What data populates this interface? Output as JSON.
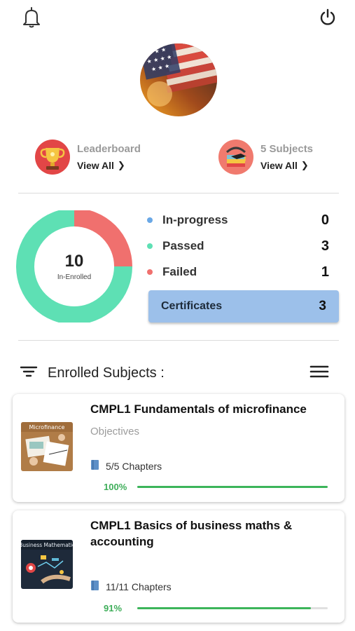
{
  "header": {
    "bell_icon": "bell-icon",
    "power_icon": "power-icon"
  },
  "profile": {
    "avatar_icon": "american-flag-avatar"
  },
  "shortcuts": {
    "leaderboard": {
      "title": "Leaderboard",
      "link": "View All",
      "icon": "trophy-icon"
    },
    "subjects": {
      "title": "5 Subjects",
      "link": "View All",
      "icon": "graduation-icon"
    }
  },
  "summary": {
    "total": "10",
    "total_label": "In-Enrolled",
    "stats": [
      {
        "label": "In-progress",
        "value": "0",
        "color": "#6aa8e6"
      },
      {
        "label": "Passed",
        "value": "3",
        "color": "#5ee0b4"
      },
      {
        "label": "Failed",
        "value": "1",
        "color": "#f0706e"
      }
    ],
    "certificates": {
      "label": "Certificates",
      "value": "3"
    },
    "donut": {
      "passed_fraction": 0.75,
      "failed_fraction": 0.25,
      "passed_color": "#5ee0b4",
      "failed_color": "#f0706e"
    }
  },
  "enrolled": {
    "title": "Enrolled Subjects :",
    "filter_icon": "filter-icon",
    "menu_icon": "menu-icon",
    "courses": [
      {
        "title": "CMPL1 Fundamentals of microfinance",
        "subtitle": "Objectives",
        "thumb_text": "Microfinance",
        "chapters": "5/5 Chapters",
        "progress_label": "100%",
        "progress": 1.0
      },
      {
        "title": "CMPL1 Basics of business maths & accounting",
        "thumb_text": "Business Mathematic",
        "chapters": "11/11 Chapters",
        "progress_label": "91%",
        "progress": 0.91
      }
    ]
  }
}
